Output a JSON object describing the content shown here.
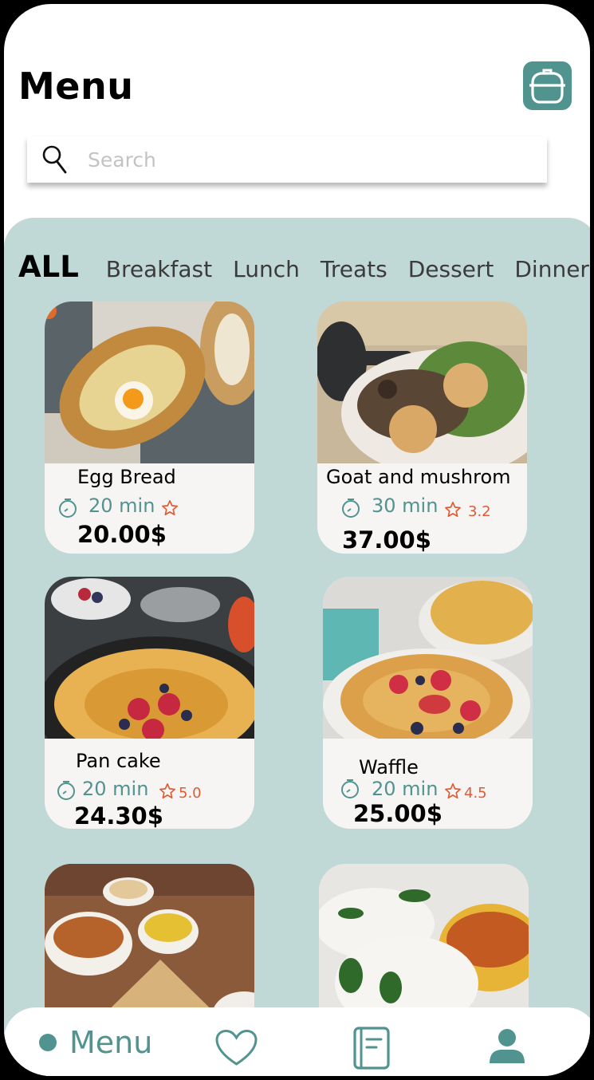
{
  "header": {
    "title": "Menu",
    "cart_icon": "cooking-pot-icon"
  },
  "search": {
    "placeholder": "Search",
    "value": ""
  },
  "tabs": [
    {
      "label": "ALL",
      "active": true
    },
    {
      "label": "Breakfast",
      "active": false
    },
    {
      "label": "Lunch",
      "active": false
    },
    {
      "label": "Treats",
      "active": false
    },
    {
      "label": "Dessert",
      "active": false
    },
    {
      "label": "Dinner",
      "active": false
    }
  ],
  "cards": [
    {
      "name": "Egg Bread",
      "time": "20 min",
      "rating": "",
      "price": "20.00$",
      "image": "egg-bread-photo"
    },
    {
      "name": "Goat and mushrom",
      "time": "30 min",
      "rating": "3.2",
      "price": "37.00$",
      "image": "goat-mushroom-salad-photo"
    },
    {
      "name": "Pan cake",
      "time": "20 min",
      "rating": "5.0",
      "price": "24.30$",
      "image": "pancake-photo"
    },
    {
      "name": "Waffle",
      "time": "20 min",
      "rating": "4.5",
      "price": "25.00$",
      "image": "waffle-photo"
    },
    {
      "name": "",
      "image": "dosa-sambar-photo"
    },
    {
      "name": "",
      "image": "idli-sambar-photo"
    }
  ],
  "bottom_nav": {
    "menu_label": "Menu",
    "icons": [
      "heart-icon",
      "recipe-book-icon",
      "user-icon"
    ]
  },
  "colors": {
    "accent": "#51948f",
    "content_bg": "#c0d8d6",
    "rating": "#e05a32",
    "card_bg": "#f7f4f4"
  }
}
